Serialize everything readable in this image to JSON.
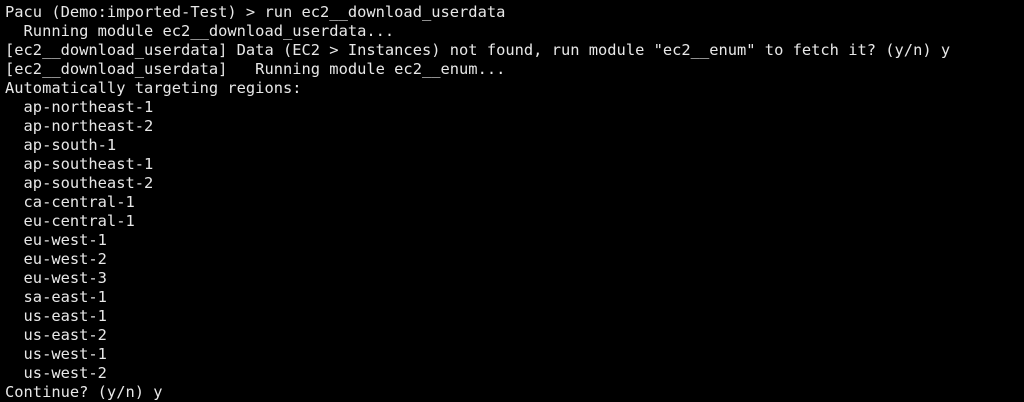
{
  "terminal": {
    "lines": [
      "Pacu (Demo:imported-Test) > run ec2__download_userdata",
      "  Running module ec2__download_userdata...",
      "[ec2__download_userdata] Data (EC2 > Instances) not found, run module \"ec2__enum\" to fetch it? (y/n) y",
      "[ec2__download_userdata]   Running module ec2__enum...",
      "Automatically targeting regions:",
      "  ap-northeast-1",
      "  ap-northeast-2",
      "  ap-south-1",
      "  ap-southeast-1",
      "  ap-southeast-2",
      "  ca-central-1",
      "  eu-central-1",
      "  eu-west-1",
      "  eu-west-2",
      "  eu-west-3",
      "  sa-east-1",
      "  us-east-1",
      "  us-east-2",
      "  us-west-1",
      "  us-west-2",
      "Continue? (y/n) y"
    ]
  },
  "colors": {
    "background": "#000000",
    "foreground": "#e8e8e8"
  }
}
